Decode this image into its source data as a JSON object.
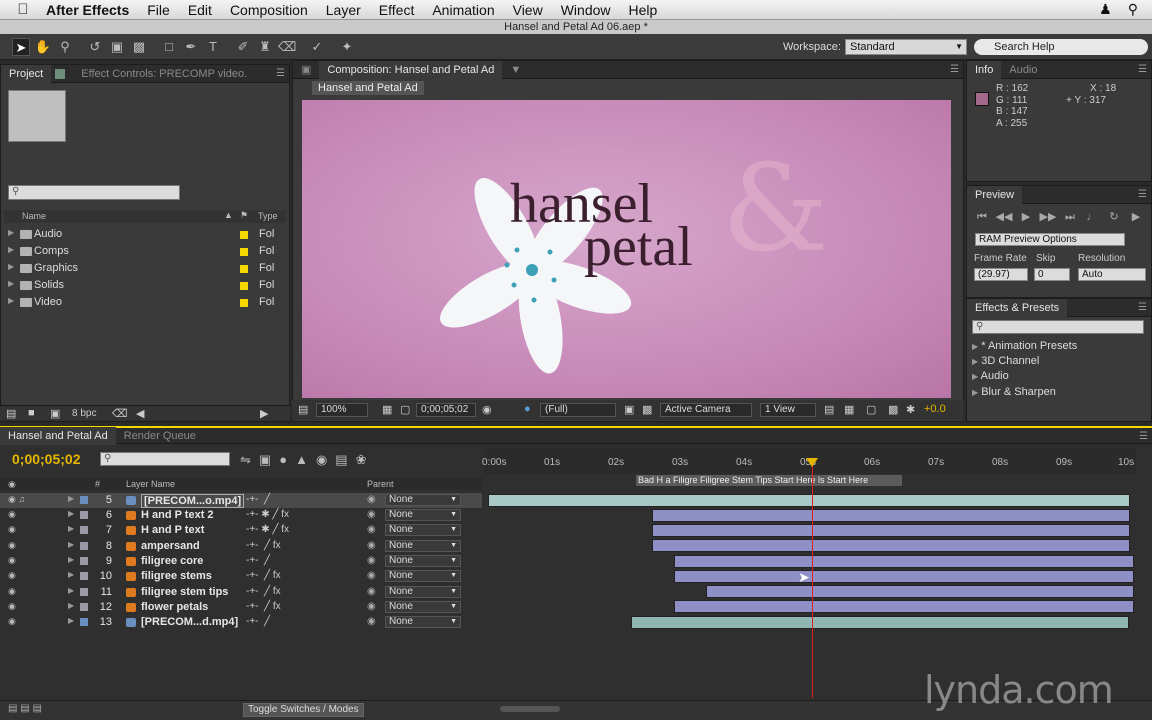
{
  "menubar": {
    "app": "After Effects",
    "items": [
      "File",
      "Edit",
      "Composition",
      "Layer",
      "Effect",
      "Animation",
      "View",
      "Window",
      "Help"
    ]
  },
  "window": {
    "title": "Hansel and Petal Ad 06.aep *"
  },
  "toolbar": {
    "workspace_label": "Workspace:",
    "workspace_value": "Standard",
    "search_help": "Search Help"
  },
  "project": {
    "tabs": [
      "Project",
      "Effect Controls: PRECOMP video."
    ],
    "col_name": "Name",
    "col_type": "Type",
    "items": [
      {
        "name": "Audio",
        "type": "Fol"
      },
      {
        "name": "Comps",
        "type": "Fol"
      },
      {
        "name": "Graphics",
        "type": "Fol"
      },
      {
        "name": "Solids",
        "type": "Fol"
      },
      {
        "name": "Video",
        "type": "Fol"
      }
    ],
    "bpc": "8 bpc"
  },
  "composition": {
    "tab": "Composition: Hansel and Petal Ad",
    "tag": "Hansel and Petal Ad",
    "logo_line1": "hansel",
    "logo_line2": "petal",
    "amp": "&",
    "zoom": "100%",
    "timecode": "0;00;05;02",
    "resolution": "(Full)",
    "camera": "Active Camera",
    "view": "1 View",
    "exposure": "+0.0"
  },
  "info": {
    "tabs": [
      "Info",
      "Audio"
    ],
    "r": "R : 162",
    "g": "G : 111",
    "b": "B : 147",
    "a": "A : 255",
    "x": "X : 18",
    "y": "Y : 317"
  },
  "preview": {
    "tab": "Preview",
    "ram": "RAM Preview Options",
    "frame_rate_label": "Frame Rate",
    "skip_label": "Skip",
    "resolution_label": "Resolution",
    "frame_rate": "(29.97)",
    "skip": "0",
    "resolution": "Auto"
  },
  "effects": {
    "tab": "Effects & Presets",
    "items": [
      "* Animation Presets",
      "3D Channel",
      "Audio",
      "Blur & Sharpen"
    ]
  },
  "timeline": {
    "tabs": [
      "Hansel and Petal Ad",
      "Render Queue"
    ],
    "timecode": "0;00;05;02",
    "layer_name_header": "Layer Name",
    "parent_header": "Parent",
    "ruler": [
      "0:00s",
      "01s",
      "02s",
      "03s",
      "04s",
      "05s",
      "06s",
      "07s",
      "08s",
      "09s",
      "10s"
    ],
    "markers": "Bad  H a  Filigre  Filigree Stem Tips Start Here  ls Start Here",
    "toggle_label": "Toggle Switches / Modes",
    "layers": [
      {
        "num": "5",
        "name": "[PRECOM...o.mp4]",
        "color": "#6a8fbf",
        "fx": false,
        "parent": "None"
      },
      {
        "num": "6",
        "name": "H and P text 2",
        "color": "#e07a1f",
        "fx": true,
        "parent": "None"
      },
      {
        "num": "7",
        "name": "H and P text",
        "color": "#e07a1f",
        "fx": true,
        "parent": "None"
      },
      {
        "num": "8",
        "name": "ampersand",
        "color": "#e07a1f",
        "fx": true,
        "parent": "None"
      },
      {
        "num": "9",
        "name": "filigree core",
        "color": "#e07a1f",
        "fx": false,
        "parent": "None"
      },
      {
        "num": "10",
        "name": "filigree stems",
        "color": "#e07a1f",
        "fx": true,
        "parent": "None"
      },
      {
        "num": "11",
        "name": "filigree stem tips",
        "color": "#e07a1f",
        "fx": true,
        "parent": "None"
      },
      {
        "num": "12",
        "name": "flower petals",
        "color": "#e07a1f",
        "fx": true,
        "parent": "None"
      },
      {
        "num": "13",
        "name": "[PRECOM...d.mp4]",
        "color": "#6a8fbf",
        "fx": false,
        "parent": "None"
      }
    ]
  },
  "watermark": "lynda.com"
}
